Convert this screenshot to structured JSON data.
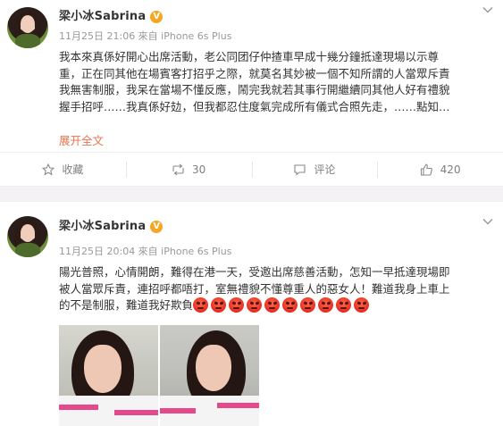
{
  "posts": [
    {
      "username": "梁小冰Sabrina",
      "badge": "V",
      "meta": "11月25日 21:06 來自 iPhone 6s Plus",
      "content_lines": [
        "我本來真係好開心出席活動，老公同团仔仲揸車早成十幾分鐘抵達現場以示尊",
        "重，正在同其他在場賓客打招乎之際，就莫名其妙被一個不知所謂的人當眾斥責",
        "我無害制服，我呆在當場不懂反應，鬧完我就若其事行開繼續同其他人好有禮貌",
        "握手招呼……我真係好攰，但我都忍住度氣完成所有儀式合照先走，……點知…"
      ],
      "expand_label": "展开全文",
      "actions": [
        {
          "icon": "star-icon",
          "label": "收藏"
        },
        {
          "icon": "repost-icon",
          "label": "30"
        },
        {
          "icon": "comment-icon",
          "label": "评论"
        },
        {
          "icon": "like-icon",
          "label": "420"
        }
      ]
    },
    {
      "username": "梁小冰Sabrina",
      "badge": "V",
      "meta": "11月25日 20:04 來自 iPhone 6s Plus",
      "content_lines": [
        "陽光普照，心情開朗，難得在港一天，受邀出席慈善活動，怎知一早抵達現場即",
        "被人當眾斥責，連招呼都唔打，室無禮貌不懂尊重人的惡女人！難道我身上車上",
        "的不是制服，難道我好欺負"
      ],
      "emoji": {
        "name": "angry-face-icon",
        "count": 10
      },
      "photos": [
        {
          "name": "selfie-photo-1"
        },
        {
          "name": "selfie-photo-2"
        }
      ]
    }
  ],
  "colors": {
    "accent": "#eb7350",
    "meta_gray": "#999999",
    "badge": "#f5a623",
    "divider": "#f4f2f4"
  }
}
